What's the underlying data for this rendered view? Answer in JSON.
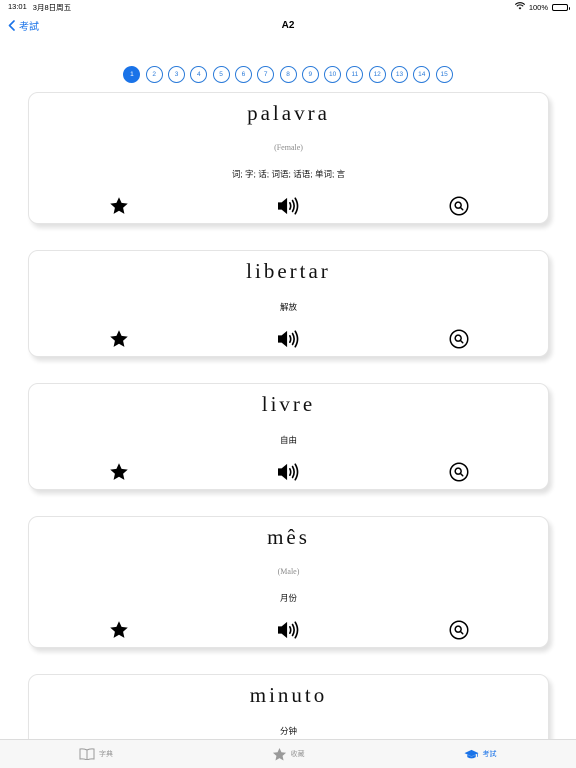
{
  "status": {
    "time": "13:01",
    "date": "3月8日周五",
    "battery": "100%"
  },
  "nav": {
    "back_label": "考試",
    "title": "A2"
  },
  "pages": [
    "1",
    "2",
    "3",
    "4",
    "5",
    "6",
    "7",
    "8",
    "9",
    "10",
    "11",
    "12",
    "13",
    "14",
    "15"
  ],
  "active_page": "1",
  "cards": [
    {
      "word": "palavra",
      "gender": "(Female)",
      "meaning": "词; 字; 话; 词语; 话语; 单词; 言"
    },
    {
      "word": "libertar",
      "gender": "",
      "meaning": "解放"
    },
    {
      "word": "livre",
      "gender": "",
      "meaning": "自由"
    },
    {
      "word": "mês",
      "gender": "(Male)",
      "meaning": "月份"
    },
    {
      "word": "minuto",
      "gender": "",
      "meaning": "分钟"
    }
  ],
  "tabs": [
    {
      "label": "字典",
      "icon": "book-icon"
    },
    {
      "label": "收藏",
      "icon": "star-icon"
    },
    {
      "label": "考試",
      "icon": "graduation-cap-icon"
    }
  ],
  "colors": {
    "accent": "#1a73e8"
  }
}
